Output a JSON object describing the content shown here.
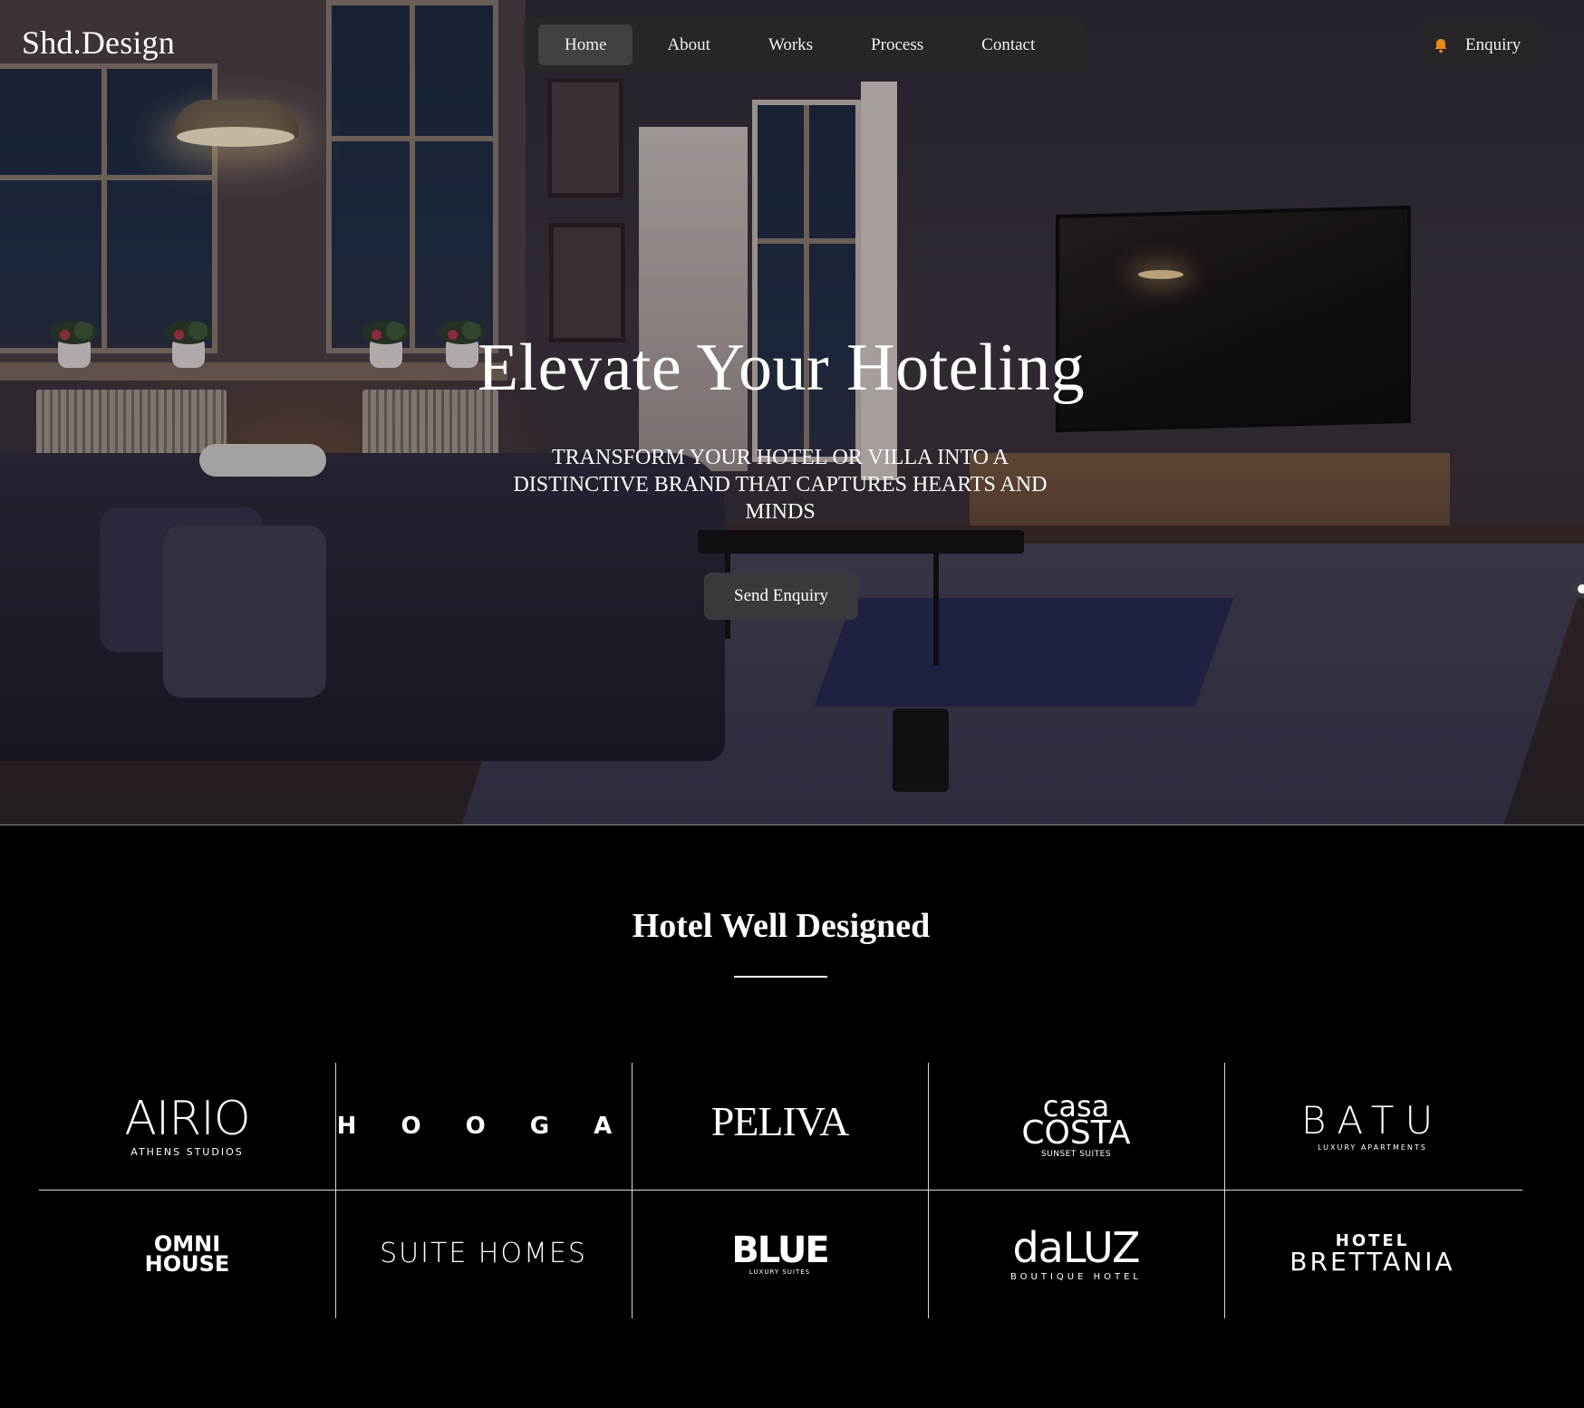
{
  "header": {
    "logo": "Shd.Design",
    "nav": [
      {
        "label": "Home",
        "active": true
      },
      {
        "label": "About",
        "active": false
      },
      {
        "label": "Works",
        "active": false
      },
      {
        "label": "Process",
        "active": false
      },
      {
        "label": "Contact",
        "active": false
      }
    ],
    "enquiry_label": "Enquiry",
    "enquiry_icon": "bell-icon",
    "accent_color": "#e8891c"
  },
  "hero": {
    "title": "Elevate Your Hoteling",
    "subtitle": "TRANSFORM YOUR HOTEL OR VILLA INTO A DISTINCTIVE BRAND THAT CAPTURES HEARTS AND MINDS",
    "cta_label": "Send Enquiry"
  },
  "section": {
    "title": "Hotel Well Designed",
    "brands": [
      {
        "name": "AIRIO",
        "sub": "ATHENS STUDIOS"
      },
      {
        "name": "H O O G A",
        "sub": ""
      },
      {
        "name": "PELIVA",
        "sub": ""
      },
      {
        "name": "casa",
        "name2": "COSTA",
        "sub": "SUNSET SUITES"
      },
      {
        "name": "BATU",
        "sub": "LUXURY APARTMENTS"
      },
      {
        "name": "OMNI",
        "name2": "HOUSE",
        "sub": ""
      },
      {
        "name": "SUITE HOMES",
        "sub": ""
      },
      {
        "name": "BLUE",
        "sub": "LUXURY SUITES"
      },
      {
        "name": "daLUZ",
        "sub": "BOUTIQUE HOTEL"
      },
      {
        "name": "HOTEL",
        "name2": "BRETTANIA",
        "sub": ""
      }
    ]
  }
}
